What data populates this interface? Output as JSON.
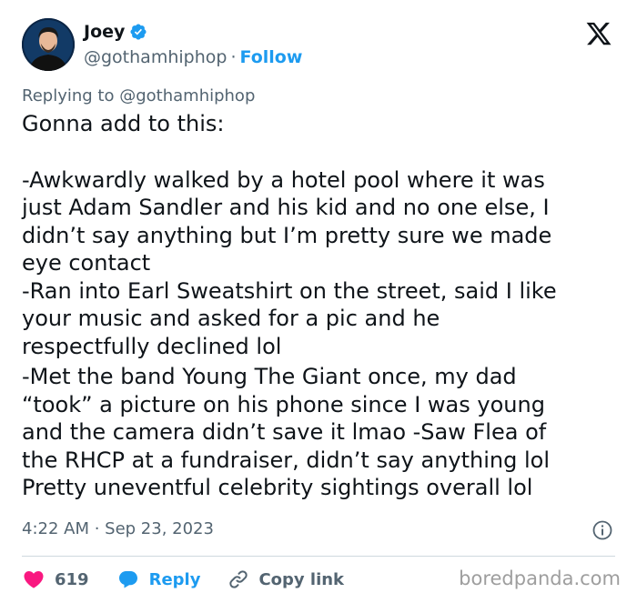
{
  "author": {
    "name": "Joey",
    "handle": "@gothamhiphop",
    "separator": "·",
    "follow_label": "Follow"
  },
  "reply_context": {
    "prefix": "Replying to",
    "mention": "@gothamhiphop"
  },
  "tweet": {
    "lines": [
      "Gonna add to this:",
      "-Awkwardly walked by a hotel pool where it was",
      "just Adam Sandler and his kid and no one else, I",
      "didn’t say anything but I’m pretty sure we made",
      "eye contact",
      "-Ran into Earl Sweatshirt on the street, said I like",
      "your music and asked for a pic and he",
      "respectfully declined lol",
      "-Met the band Young The Giant once, my dad",
      "“took” a picture on his phone since I was young",
      "and the camera didn’t save it lmao -Saw Flea of",
      "the RHCP at a fundraiser, didn’t say anything lol",
      "Pretty uneventful celebrity sightings overall lol"
    ]
  },
  "timestamp": "4:22 AM · Sep 23, 2023",
  "actions": {
    "likes": "619",
    "reply_label": "Reply",
    "copy_link_label": "Copy link"
  },
  "watermark": "boredpanda.com",
  "colors": {
    "accent": "#1d9bf0",
    "like": "#f91880",
    "muted": "#536471",
    "text": "#0f1419"
  },
  "icons": [
    "verified-badge-icon",
    "x-logo-icon",
    "info-icon",
    "heart-icon",
    "reply-bubble-icon",
    "link-icon"
  ]
}
